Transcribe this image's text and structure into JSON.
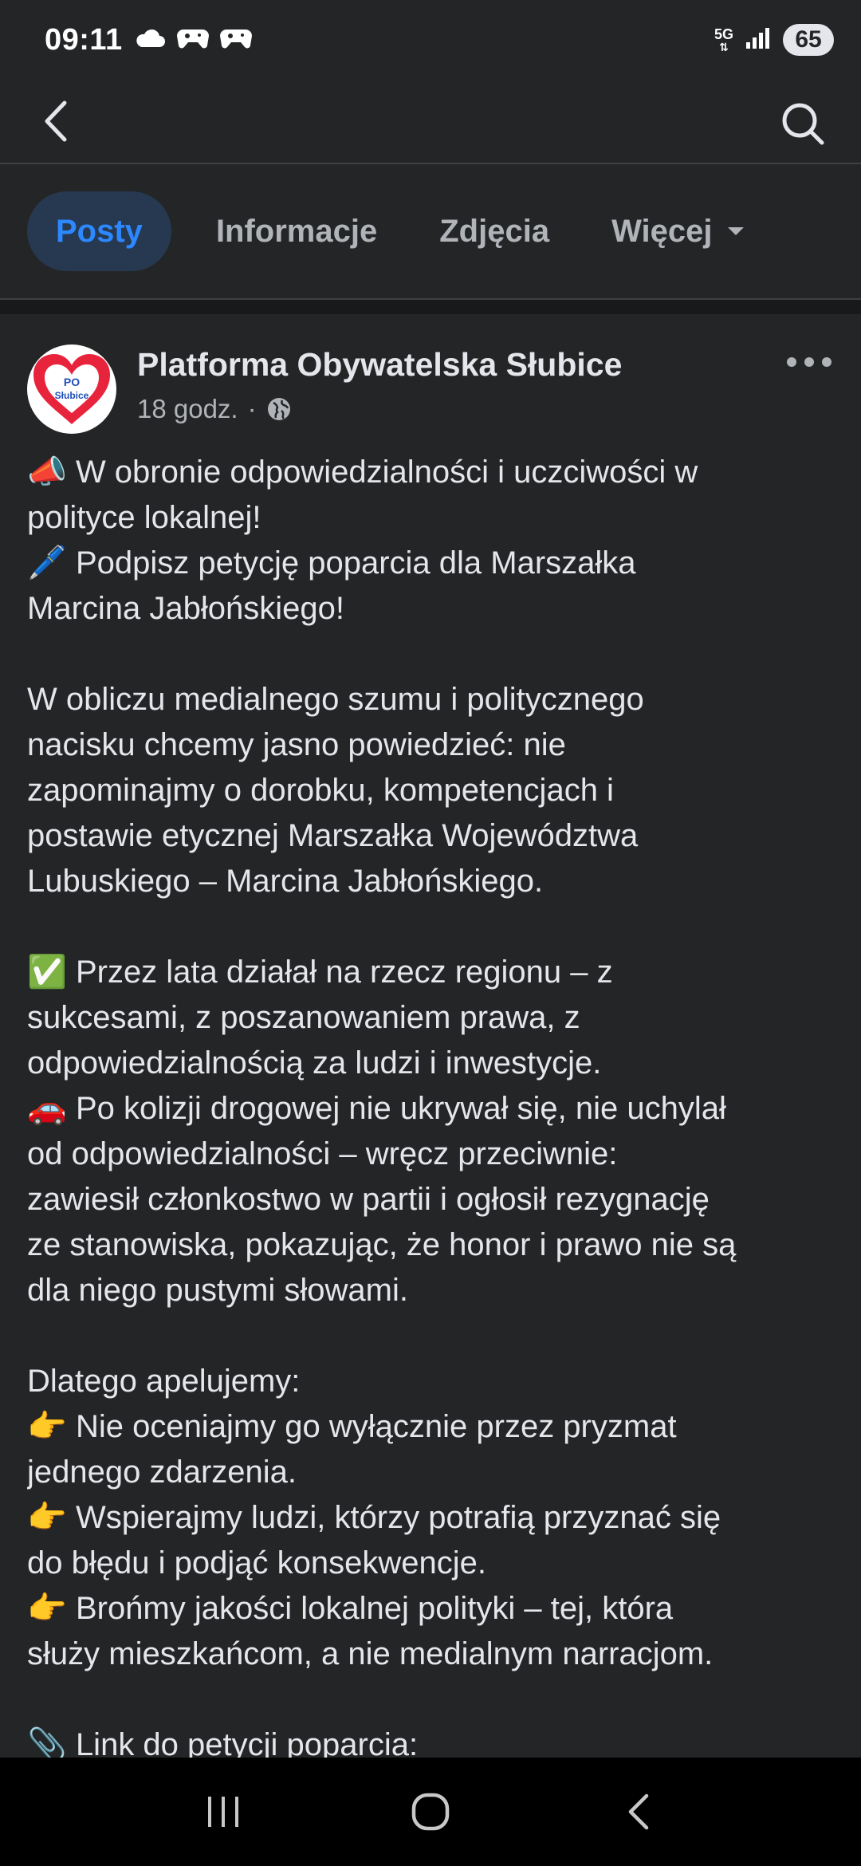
{
  "status_bar": {
    "time": "09:11",
    "network": "5G",
    "battery": "65",
    "icons": [
      "cloud-icon",
      "game-controller-icon",
      "game-controller-icon",
      "signal-icon"
    ]
  },
  "top_nav": {
    "back_icon": "chevron-left-icon",
    "search_icon": "search-icon"
  },
  "tabs": [
    {
      "label": "Posty",
      "active": true
    },
    {
      "label": "Informacje",
      "active": false
    },
    {
      "label": "Zdjęcia",
      "active": false
    },
    {
      "label": "Więcej",
      "active": false
    }
  ],
  "post": {
    "author": "Platforma Obywatelska Słubice",
    "avatar_text_top": "PO",
    "avatar_text_bottom": "Słubice",
    "time": "18 godz.",
    "separator": "·",
    "privacy_icon": "globe-icon",
    "more_icon": "more-horizontal-icon",
    "lines": [
      {
        "emoji": "📣",
        "text": "W obronie odpowiedzialności i uczciwości w"
      },
      {
        "text": "polityce lokalnej!"
      },
      {
        "emoji": "🖊️",
        "text": "Podpisz petycję poparcia dla Marszałka"
      },
      {
        "text": "Marcina Jabłońskiego!"
      },
      {
        "blank": true
      },
      {
        "text": "W obliczu medialnego szumu i politycznego"
      },
      {
        "text": "nacisku chcemy jasno powiedzieć: nie"
      },
      {
        "text": "zapominajmy o dorobku, kompetencjach i"
      },
      {
        "text": "postawie etycznej Marszałka Województwa"
      },
      {
        "text": "Lubuskiego – Marcina Jabłońskiego."
      },
      {
        "blank": true
      },
      {
        "emoji": "✅",
        "text": "Przez lata działał na rzecz regionu – z"
      },
      {
        "text": "sukcesami, z poszanowaniem prawa, z"
      },
      {
        "text": "odpowiedzialnością za ludzi i inwestycje."
      },
      {
        "emoji": "🚗",
        "text": "Po kolizji drogowej nie ukrywał się, nie uchylał"
      },
      {
        "text": "od odpowiedzialności – wręcz przeciwnie:"
      },
      {
        "text": "zawiesił członkostwo w partii i ogłosił rezygnację"
      },
      {
        "text": "ze stanowiska, pokazując, że honor i prawo nie są"
      },
      {
        "text": "dla niego pustymi słowami."
      },
      {
        "blank": true
      },
      {
        "text": "Dlatego apelujemy:"
      },
      {
        "emoji": "👉",
        "text": "Nie oceniajmy go wyłącznie przez pryzmat"
      },
      {
        "text": "jednego zdarzenia."
      },
      {
        "emoji": "👉",
        "text": "Wspierajmy ludzi, którzy potrafią przyznać się"
      },
      {
        "text": "do błędu i podjąć konsekwencje."
      },
      {
        "emoji": "👉",
        "text": "Brońmy jakości lokalnej polityki – tej, która"
      },
      {
        "text": "służy mieszkańcom, a nie medialnym narracjom."
      },
      {
        "blank": true
      },
      {
        "emoji": "📎",
        "text": "Link do petycji poparcia:"
      }
    ]
  },
  "system_nav": {
    "recents_icon": "recent-apps-icon",
    "home_icon": "home-circle-icon",
    "back_icon": "back-chevron-icon"
  },
  "colors": {
    "background": "#242526",
    "accent": "#2d88ff",
    "active_tab_bg": "#263951",
    "muted_text": "#b0b3b8",
    "primary_text": "#e4e6eb"
  }
}
